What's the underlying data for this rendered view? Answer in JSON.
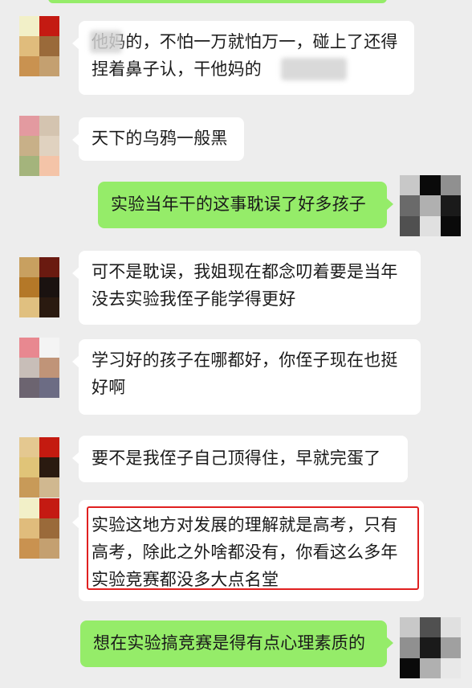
{
  "messages": [
    {
      "side": "in",
      "lines": [
        "他妈的，不怕一万就怕万一，碰上了还得",
        "捏着鼻子认，干他妈的"
      ]
    },
    {
      "side": "in",
      "lines": [
        "天下的乌鸦一般黑"
      ]
    },
    {
      "side": "out",
      "lines": [
        "实验当年干的这事耽误了好多孩子"
      ]
    },
    {
      "side": "in",
      "lines": [
        "可不是耽误，我姐现在都念叨着要是当年",
        "没去实验我侄子能学得更好"
      ]
    },
    {
      "side": "in",
      "lines": [
        "学习好的孩子在哪都好，你侄子现在也挺",
        "好啊"
      ]
    },
    {
      "side": "in",
      "lines": [
        "要不是我侄子自己顶得住，早就完蛋了"
      ]
    },
    {
      "side": "in",
      "highlighted": true,
      "lines": [
        "实验这地方对发展的理解就是高考，只有",
        "高考，除此之外啥都没有，你看这么多年",
        "实验竞赛都没多大点名堂"
      ]
    },
    {
      "side": "out",
      "lines": [
        "想在实验搞竞赛是得有点心理素质的"
      ]
    }
  ],
  "colors": {
    "background": "#ededed",
    "incoming_bubble": "#ffffff",
    "outgoing_bubble": "#95ec69",
    "highlight_box": "#e02020",
    "text": "#1a1a1a"
  },
  "avatars": {
    "a1": [
      "#f2f0c8",
      "#c41a12",
      "#e0bc7c",
      "#9a6a3a",
      "#c99250",
      "#c4a070"
    ],
    "a2": [
      "#e39aa0",
      "#d4c4b0",
      "#c8b088",
      "#e0d2c0",
      "#a4b47c",
      "#f4c4a8"
    ],
    "a3": [
      "#c8a060",
      "#6a1a10",
      "#b47828",
      "#1a1210",
      "#e0c080",
      "#2a1a10"
    ],
    "a4": [
      "#e88890",
      "#f4f4f4",
      "#c8beb8",
      "#c09478",
      "#6c6470",
      "#6c6c84"
    ],
    "a5": [
      "#e4c890",
      "#c41a10",
      "#e0c478",
      "#2a1a10",
      "#c89a58",
      "#d0b890"
    ],
    "a6": [
      "#f2f0c8",
      "#c41a12",
      "#e0bc7c",
      "#9a6a3a",
      "#c99250",
      "#c4a070"
    ],
    "me1": [
      "#c8c8c8",
      "#0a0a0a",
      "#909090",
      "#6a6a6a",
      "#b0b0b0",
      "#1a1a1a",
      "#505050",
      "#e0e0e0",
      "#0a0a0a"
    ],
    "me2": [
      "#c8c8c8",
      "#505050",
      "#e0e0e0",
      "#909090",
      "#1a1a1a",
      "#a0a0a0",
      "#0a0a0a",
      "#b0b0b0",
      "#e8e8e8"
    ]
  }
}
